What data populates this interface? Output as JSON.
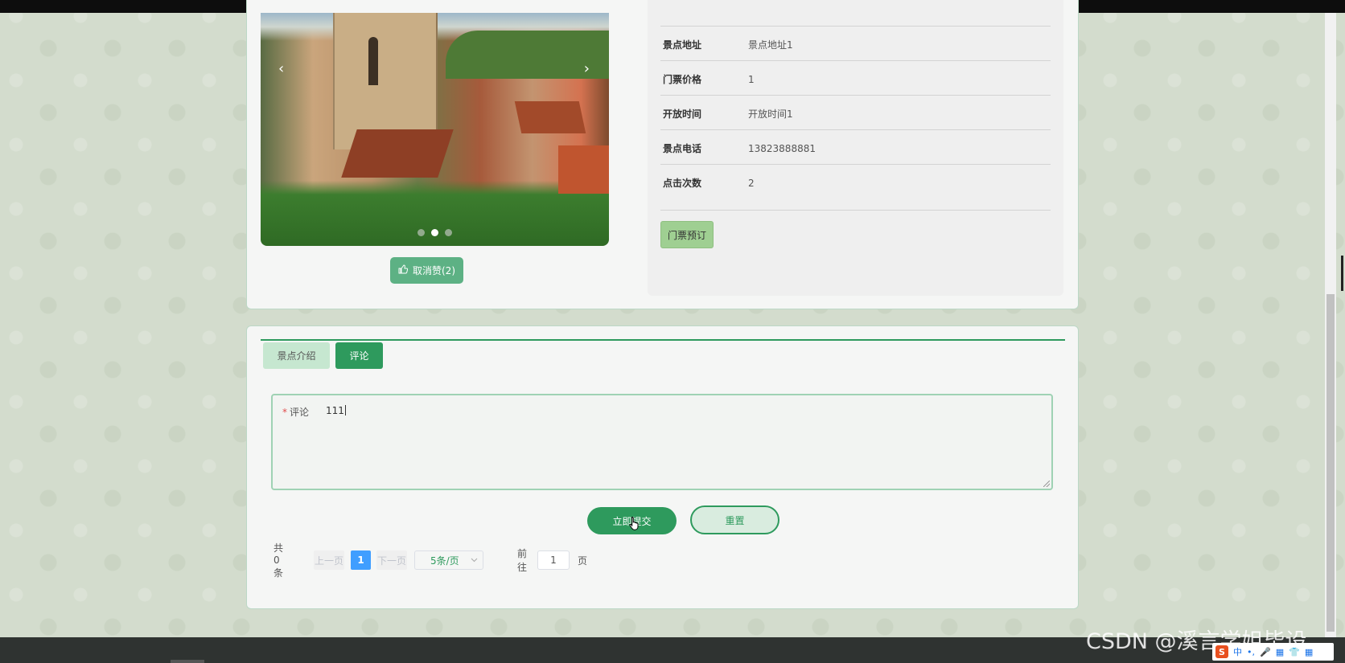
{
  "carousel": {
    "prev": "‹",
    "next": "›",
    "dots_count": 3,
    "active_index": 1
  },
  "like_button": {
    "label": "取消赞(2)",
    "icon": "thumbs-up-icon"
  },
  "details": [
    {
      "label": "景点地址",
      "value": "景点地址1"
    },
    {
      "label": "门票价格",
      "value": "1"
    },
    {
      "label": "开放时间",
      "value": "开放时间1"
    },
    {
      "label": "景点电话",
      "value": "13823888881"
    },
    {
      "label": "点击次数",
      "value": "2"
    }
  ],
  "ticket_button": "门票预订",
  "tabs": [
    {
      "label": "景点介绍",
      "active": false
    },
    {
      "label": "评论",
      "active": true
    }
  ],
  "comment_form": {
    "required_mark": "*",
    "label": "评论",
    "value": "111",
    "submit_label": "立即提交",
    "reset_label": "重置"
  },
  "pagination": {
    "total": "共 0 条",
    "prev": "上一页",
    "current_page": "1",
    "next": "下一页",
    "page_size": "5条/页",
    "goto_prefix": "前往",
    "goto_value": "1",
    "goto_suffix": "页"
  },
  "watermark": "CSDN @溪言学姐毕设",
  "tray": {
    "s": "S",
    "lang": "中",
    "dot": "•,",
    "mic": "🎤",
    "kbd": "▦",
    "shirt": "👕",
    "grid": "▦"
  },
  "colors": {
    "accent": "#2e9a5d",
    "ticket": "#9fcf92",
    "like": "#5db184",
    "page_active": "#409eff"
  }
}
